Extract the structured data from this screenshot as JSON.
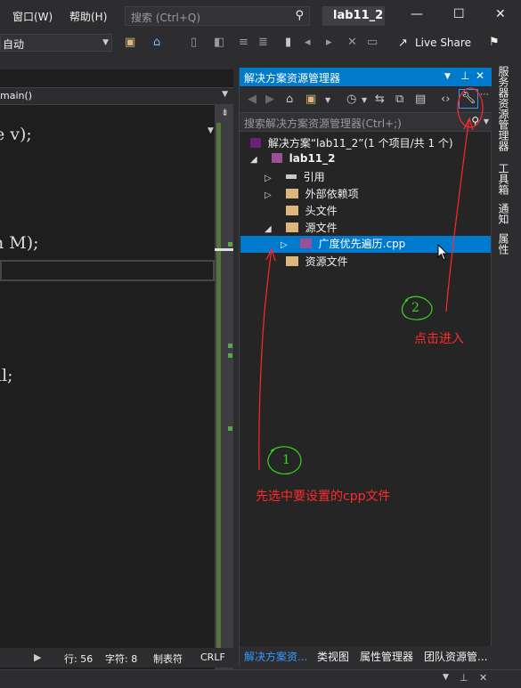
{
  "menu": {
    "window_label": "窗口(W)",
    "help_label": "帮助(H)",
    "search_placeholder": "搜索 (Ctrl+Q)",
    "solution_name": "lab11_2",
    "minimize": "—",
    "maximize": "☐",
    "close": "✕"
  },
  "toolbar": {
    "config_value": "自动",
    "live_share_label": "Live Share"
  },
  "editor": {
    "nav_value": "main()",
    "code_lines": [
      "e v);",
      "n M);",
      "ll;"
    ],
    "status": {
      "line": "行: 56",
      "char": "字符: 8",
      "tabs": "制表符",
      "eol": "CRLF"
    }
  },
  "solution_explorer": {
    "title": "解决方案资源管理器",
    "search_placeholder": "搜索解决方案资源管理器(Ctrl+;)",
    "tree": [
      {
        "label": "解决方案“lab11_2”(1 个项目/共 1 个)",
        "arrow": ""
      },
      {
        "label": "lab11_2",
        "arrow": "◢"
      },
      {
        "label": "引用",
        "arrow": "▷"
      },
      {
        "label": "外部依赖项",
        "arrow": "▷"
      },
      {
        "label": "头文件",
        "arrow": ""
      },
      {
        "label": "源文件",
        "arrow": "◢"
      },
      {
        "label": "广度优先遍历.cpp",
        "arrow": "▷"
      },
      {
        "label": "资源文件",
        "arrow": ""
      }
    ],
    "tabs": [
      "解决方案资...",
      "类视图",
      "属性管理器",
      "团队资源管..."
    ]
  },
  "side_tabs": [
    "服务器资源管理器",
    "工具箱",
    "通知",
    "属性"
  ],
  "annotations": {
    "step1_number": "1",
    "step1_text": "先选中要设置的cpp文件",
    "step2_number": "2",
    "step2_text": "点击进入"
  },
  "colors": {
    "accent": "#007acc",
    "annotation_red": "#ff2a2a",
    "annotation_green": "#39d41f"
  }
}
